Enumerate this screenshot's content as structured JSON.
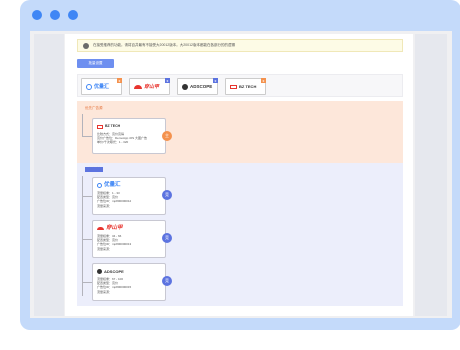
{
  "notice": {
    "text": "在接受推荐的功能。请将百井最有不接受大20012版本。大20012版本都能在各部分的的逻辑"
  },
  "toolbar": {
    "add_button": "批量设置"
  },
  "platforms": [
    {
      "name": "优量汇",
      "badge": "0",
      "badge_color": "#f4924e",
      "icon_color": "#3f86f5"
    },
    {
      "name": "穿山甲",
      "badge": "0",
      "badge_color": "#5c73e0",
      "icon_color": "#e8352f"
    },
    {
      "name": "ADSCOPE",
      "badge": "0",
      "badge_color": "#5c73e0",
      "icon_color": "#333333"
    },
    {
      "name": "BZ TECH",
      "badge": "0",
      "badge_color": "#f4924e",
      "icon_color": "#e8352f"
    }
  ],
  "section_primary": {
    "title": "优先广告源",
    "node": {
      "name": "BZ TECH",
      "lines": [
        "比较方式：竞价竞得",
        "竞价广告位：DemoApp iOS 大图广告",
        "单价/千次曝光：1 - 320"
      ],
      "circle_label": "主"
    }
  },
  "section_secondary": {
    "title": "常规广告源",
    "nodes": [
      {
        "name": "优量汇",
        "lines": [
          "流量权重：1 - 33",
          "配置类型：竞价",
          "广告位ID：mp800000012",
          "流量来源："
        ],
        "circle_label": "竞"
      },
      {
        "name": "穿山甲",
        "lines": [
          "流量权重：34 - 66",
          "配置类型：竞价",
          "广告位ID：mp800000013",
          "流量来源："
        ],
        "circle_label": "竞"
      },
      {
        "name": "ADSCOPE",
        "lines": [
          "流量权重：67 - 100",
          "配置类型：竞价",
          "广告位ID：mp800000015",
          "流量来源："
        ],
        "circle_label": "竞"
      }
    ]
  }
}
